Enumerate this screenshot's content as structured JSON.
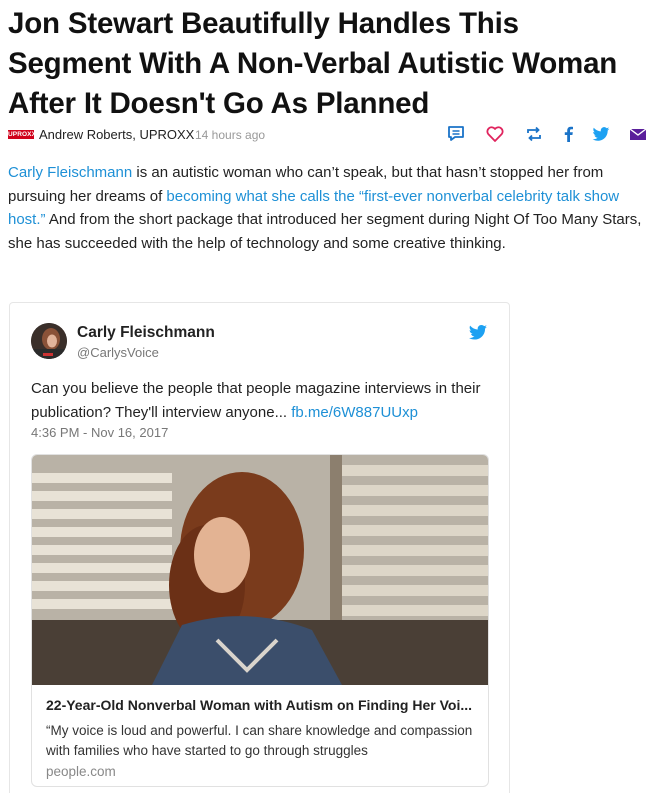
{
  "article": {
    "headline": "Jon Stewart Beautifully Handles This Segment With A Non-Verbal Autistic Woman After It Doesn't Go As Planned",
    "logo_text": "UPROXX",
    "author": "Andrew Roberts,",
    "publication": "UPROXX",
    "time": "14 hours ago",
    "body": {
      "link1": "Carly Fleischmann",
      "text1": " is an autistic woman who can’t speak, but that hasn’t stopped her from pursuing her dreams of ",
      "link2": "becoming what she calls the “first-ever nonverbal celebrity talk show host.”",
      "text2": " And from the short package that introduced her segment during Night Of Too Many Stars, she has succeeded with the help of technology and some creative thinking."
    }
  },
  "share_icons": [
    "comment-icon",
    "heart-icon",
    "retweet-icon",
    "facebook-icon",
    "twitter-icon",
    "email-icon"
  ],
  "colors": {
    "accent": "#1e90d6",
    "logo_red": "#d0021b",
    "share_icon": "#1a73c8"
  },
  "tweet": {
    "name": "Carly Fleischmann",
    "handle": "@CarlysVoice",
    "text": "Can you believe the people that people magazine interviews in their publication? They'll interview anyone... ",
    "link": "fb.me/6W887UUxp",
    "date": "4:36 PM - Nov 16, 2017",
    "card": {
      "title": "22-Year-Old Nonverbal Woman with Autism on Finding Her Voi...",
      "description": "“My voice is loud and powerful. I can share knowledge and compassion with families who have started to go through struggles",
      "domain": "people.com"
    }
  }
}
